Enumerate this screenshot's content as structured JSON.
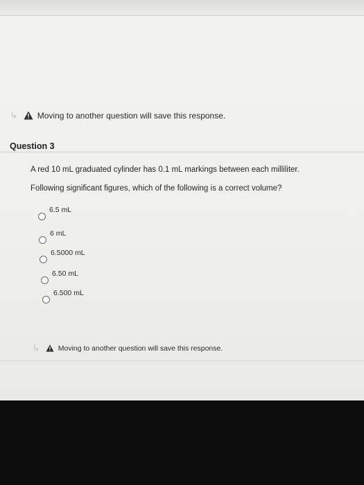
{
  "notice_top": {
    "text": "Moving to another question will save this response."
  },
  "question": {
    "heading": "Question 3",
    "line1": "A red 10 mL graduated cylinder has 0.1 mL markings between each milliliter.",
    "line2": "Following significant figures, which of the following is a correct volume?",
    "options": [
      "6.5 mL",
      "6 mL",
      "6.5000 mL",
      "6.50 mL",
      "6.500 mL"
    ]
  },
  "notice_bottom": {
    "text": "Moving to another question will save this response."
  },
  "icons": {
    "arrow": "return-arrow-icon",
    "warning": "warning-icon"
  },
  "colors": {
    "warning_fill": "#2b2b2b",
    "page_bg": "#f1f1ef",
    "bezel": "#0c0c0c"
  }
}
